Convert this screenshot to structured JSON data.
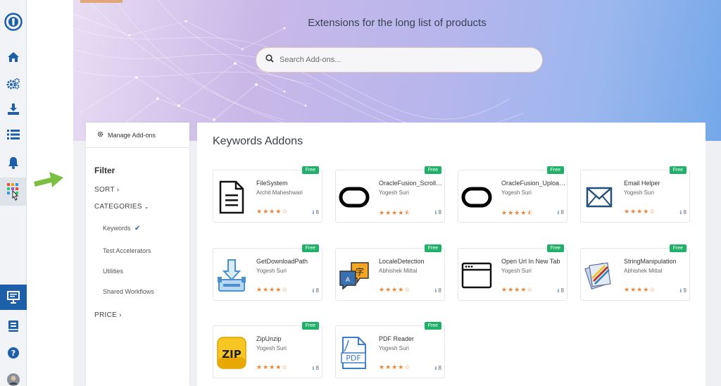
{
  "hero": {
    "title": "Extensions for the long list of products",
    "search_placeholder": "Search Add-ons..."
  },
  "sidebar_left": {
    "icons": [
      "logo-icon",
      "home-icon",
      "settings-icon",
      "download-icon",
      "list-icon",
      "bell-icon",
      "addons-grid-icon",
      "presentation-icon",
      "book-icon",
      "help-icon",
      "avatar"
    ]
  },
  "filter": {
    "manage_label": "Manage Add-ons",
    "title": "Filter",
    "sort_label": "SORT",
    "categories_label": "CATEGORIES",
    "categories": [
      {
        "label": "Keywords",
        "selected": true
      },
      {
        "label": "Test Accelerators",
        "selected": false
      },
      {
        "label": "Utilities",
        "selected": false
      },
      {
        "label": "Shared Workflows",
        "selected": false
      }
    ],
    "price_label": "PRICE"
  },
  "main": {
    "title": "Keywords Addons",
    "cards": [
      {
        "name": "FileSystem",
        "author": "Archit Maheshwari",
        "badge": "Free",
        "rating": 4,
        "downloads": "8",
        "icon": "document-icon"
      },
      {
        "name": "OracleFusion_ScrollTa...",
        "author": "Yogesh Suri",
        "badge": "Free",
        "rating": 4.5,
        "downloads": "8",
        "icon": "oracle-icon"
      },
      {
        "name": "OracleFusion_Upload...",
        "author": "Yogesh Suri",
        "badge": "Free",
        "rating": 4.5,
        "downloads": "8",
        "icon": "oracle-icon"
      },
      {
        "name": "Email Helper",
        "author": "Yogesh Suri",
        "badge": "Free",
        "rating": 4,
        "downloads": "8",
        "icon": "envelope-icon"
      },
      {
        "name": "GetDownloadPath",
        "author": "Yogesh Suri",
        "badge": "Free",
        "rating": 4,
        "downloads": "8",
        "icon": "download-tray-icon"
      },
      {
        "name": "LocaleDetection",
        "author": "Abhishek Mittal",
        "badge": "Free",
        "rating": 4,
        "downloads": "8",
        "icon": "translate-icon"
      },
      {
        "name": "Open Url In New Tab",
        "author": "Yogesh Suri",
        "badge": "Free",
        "rating": 4,
        "downloads": "8",
        "icon": "browser-window-icon"
      },
      {
        "name": "StringManipulation",
        "author": "Abhishek Mittal",
        "badge": "Free",
        "rating": 4,
        "downloads": "9",
        "icon": "notes-icon"
      },
      {
        "name": "ZipUnzip",
        "author": "Yogesh Suri",
        "badge": "Free",
        "rating": 4,
        "downloads": "8",
        "icon": "zip-icon"
      },
      {
        "name": "PDF Reader",
        "author": "Yogesh Suri",
        "badge": "Free",
        "rating": 4,
        "downloads": "8",
        "icon": "pdf-icon"
      }
    ]
  },
  "colors": {
    "rail_blue": "#1d5fa8",
    "badge_green": "#1fb06a",
    "star_orange": "#e8873a",
    "arrow_green": "#7bc043"
  }
}
